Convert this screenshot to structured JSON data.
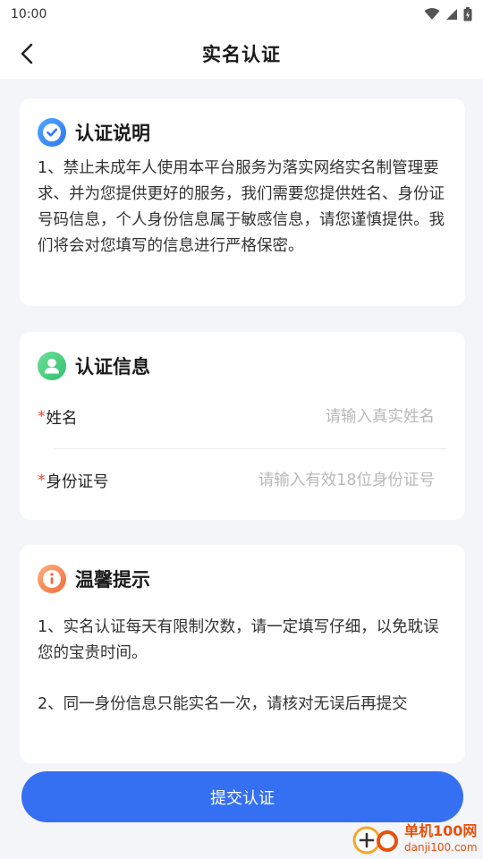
{
  "status_bar": {
    "time": "10:00"
  },
  "header": {
    "title": "实名认证"
  },
  "description_card": {
    "title": "认证说明",
    "body": "1、禁止未成年人使用本平台服务为落实网络实名制管理要求、并为您提供更好的服务，我们需要您提供姓名、身份证号码信息，个人身份信息属于敏感信息，请您谨慎提供。我们将会对您填写的信息进行严格保密。"
  },
  "info_card": {
    "title": "认证信息",
    "fields": [
      {
        "required_mark": "*",
        "label": "姓名",
        "placeholder": "请输入真实姓名",
        "value": ""
      },
      {
        "required_mark": "*",
        "label": "身份证号",
        "placeholder": "请输入有效18位身份证号",
        "value": ""
      }
    ]
  },
  "tips_card": {
    "title": "温馨提示",
    "tips": [
      "1、实名认证每天有限制次数，请一定填写仔细，以免耽误您的宝贵时间。",
      "2、同一身份信息只能实名一次，请核对无误后再提交"
    ]
  },
  "submit_label": "提交认证",
  "watermark": {
    "name": "单机100网",
    "url": "danji100.com"
  },
  "colors": {
    "primary": "#3570f3",
    "required": "#ff3b30",
    "placeholder": "#b9b9bd",
    "background": "#f4f5f9",
    "watermark": "#e8500c"
  },
  "icons": {
    "back": "chevron-left-icon",
    "description": "check-badge-icon",
    "info": "user-icon",
    "tips": "info-icon"
  }
}
